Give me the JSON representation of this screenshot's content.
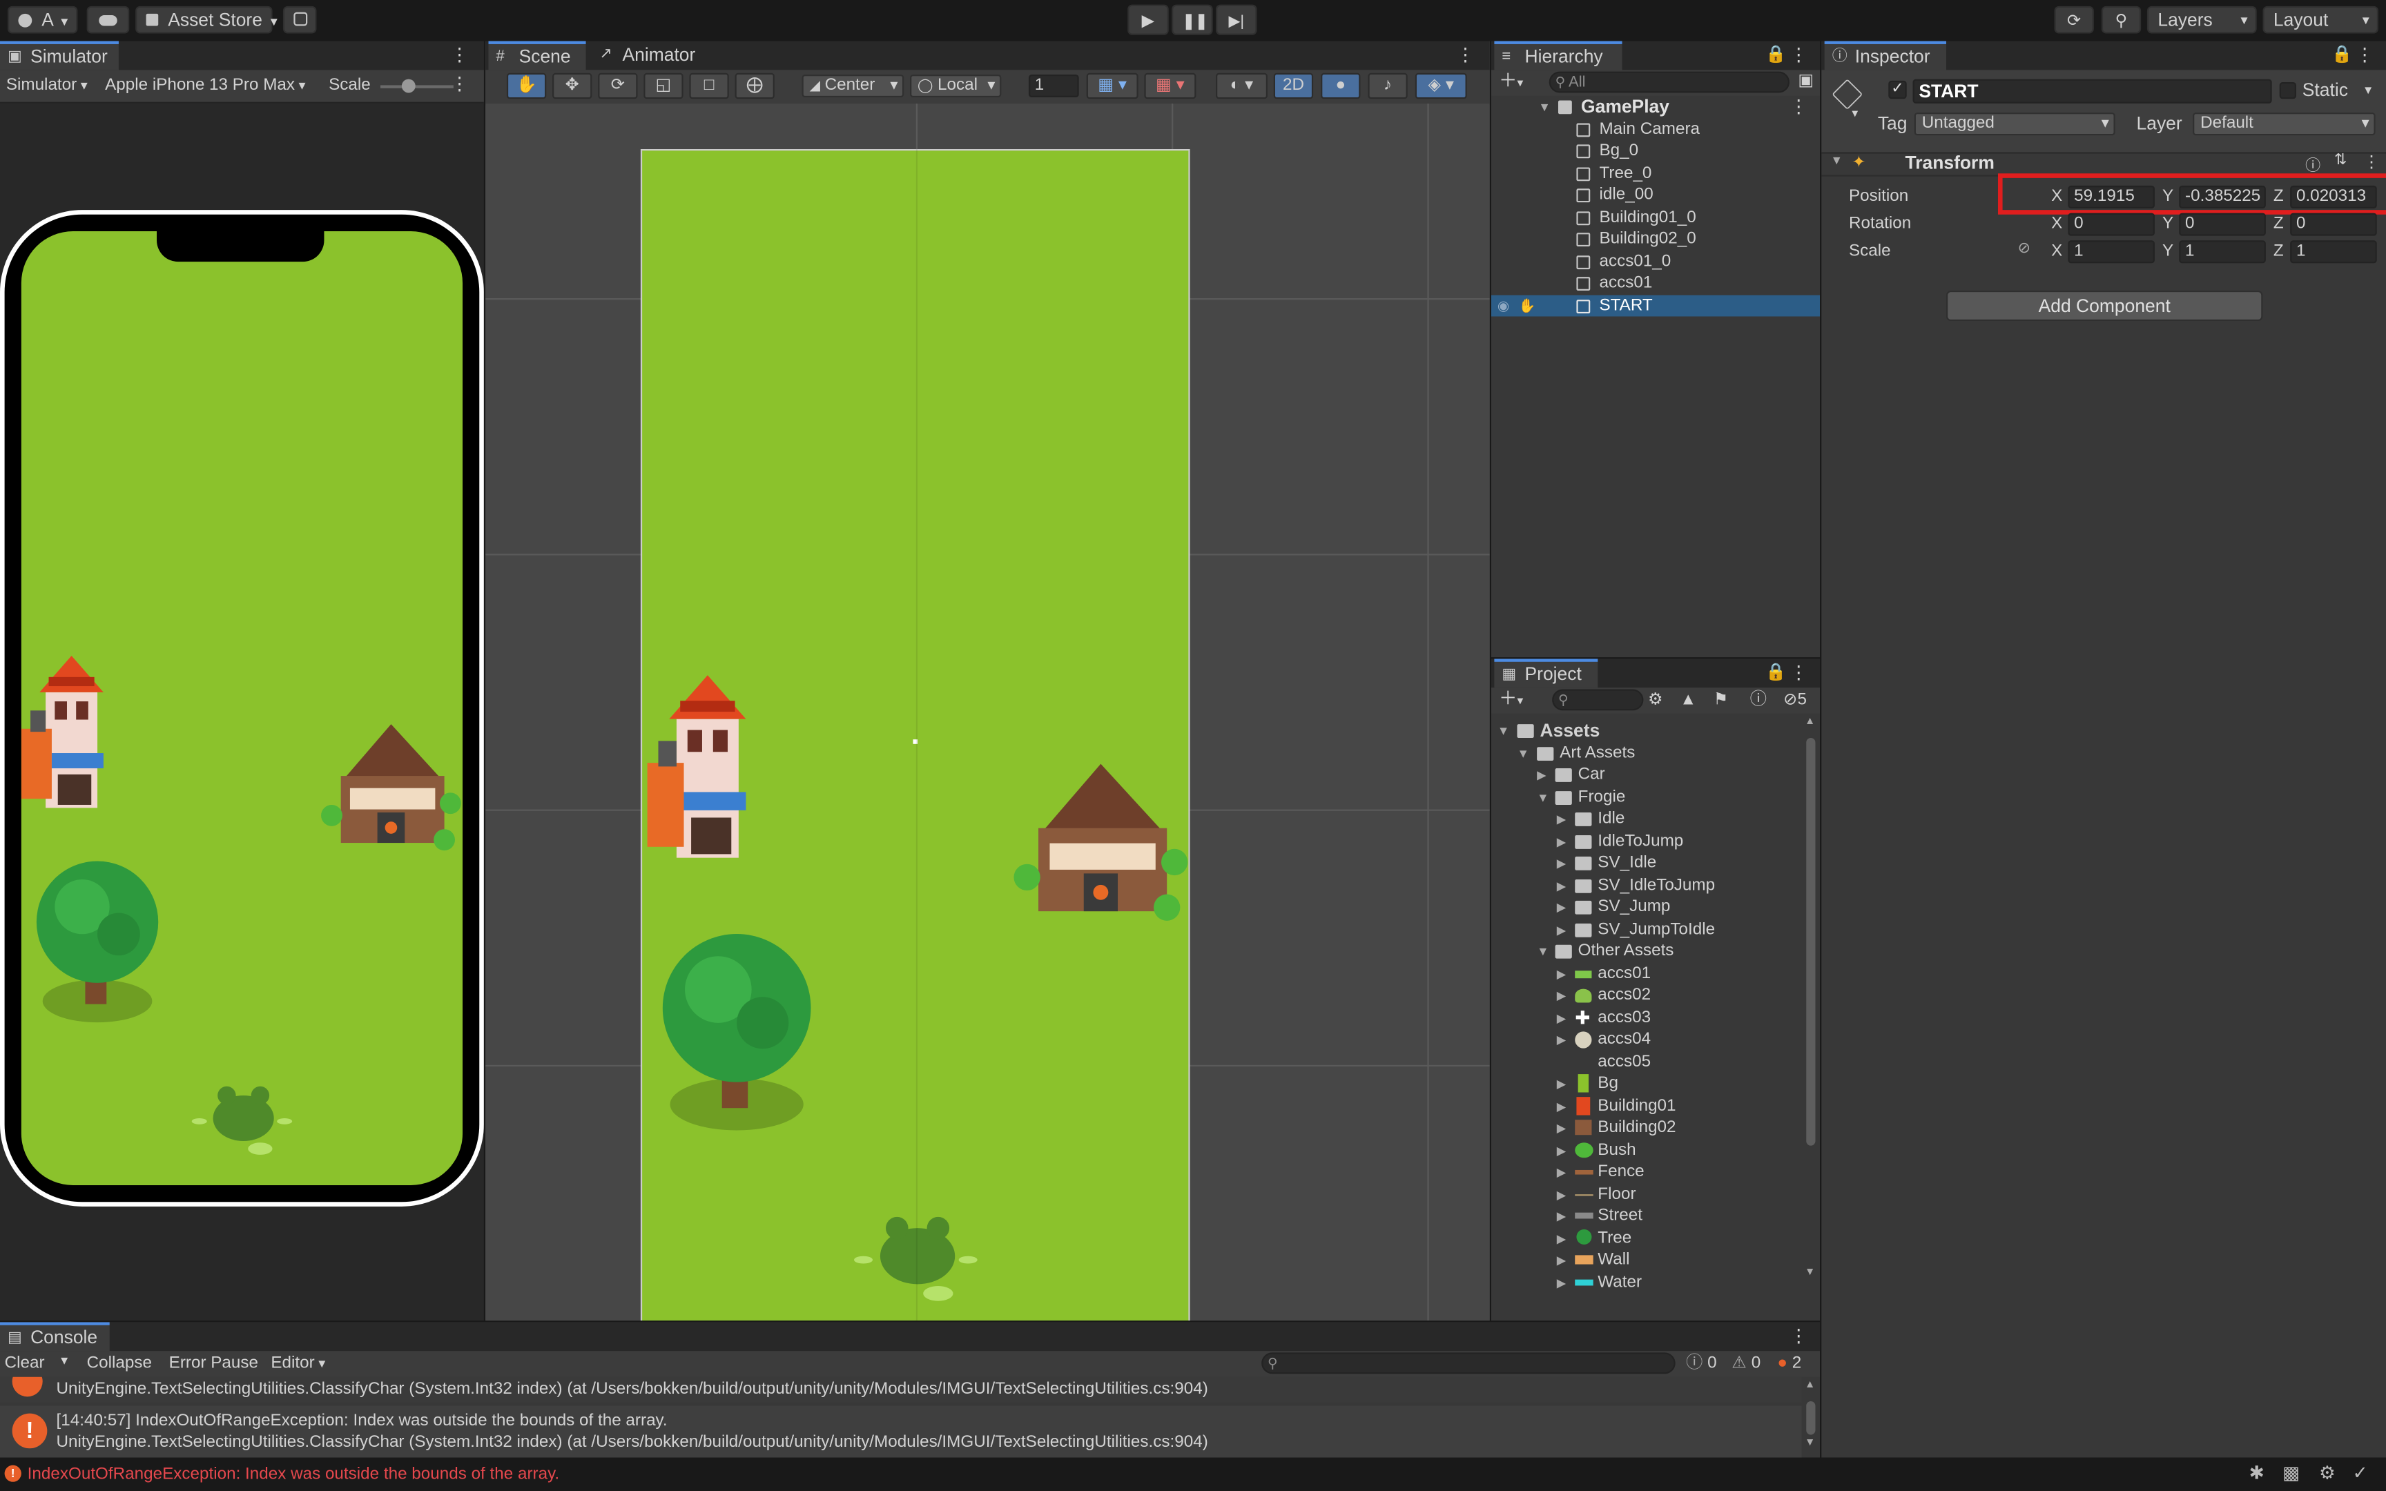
{
  "toolbar": {
    "account_label": "A",
    "asset_store_label": "Asset Store",
    "layers_label": "Layers",
    "layout_label": "Layout"
  },
  "simulator": {
    "tab_label": "Simulator",
    "mode_label": "Simulator",
    "device_label": "Apple iPhone 13 Pro Max",
    "scale_label": "Scale",
    "scale_value": 0.15
  },
  "scene": {
    "tabs": [
      "Scene",
      "Animator"
    ],
    "pivot_label": "Center",
    "space_label": "Local",
    "grid_value": "1",
    "mode_2d_label": "2D"
  },
  "hierarchy": {
    "tab_label": "Hierarchy",
    "search_placeholder": "All",
    "scene_name": "GamePlay",
    "items": [
      "Main Camera",
      "Bg_0",
      "Tree_0",
      "idle_00",
      "Building01_0",
      "Building02_0",
      "accs01_0",
      "accs01",
      "START"
    ],
    "selected": "START"
  },
  "inspector": {
    "tab_label": "Inspector",
    "object_name": "START",
    "static_label": "Static",
    "tag_label": "Tag",
    "tag_value": "Untagged",
    "layer_label": "Layer",
    "layer_value": "Default",
    "component_title": "Transform",
    "position_label": "Position",
    "rotation_label": "Rotation",
    "scale_label": "Scale",
    "axis_x": "X",
    "axis_y": "Y",
    "axis_z": "Z",
    "position": {
      "x": "59.1915",
      "y": "-0.385225",
      "z": "0.020313"
    },
    "rotation": {
      "x": "0",
      "y": "0",
      "z": "0"
    },
    "scale": {
      "x": "1",
      "y": "1",
      "z": "1"
    },
    "add_component_label": "Add Component",
    "highlight_color": "#e01e1e"
  },
  "project": {
    "tab_label": "Project",
    "hidden_count": "5",
    "root": "Assets",
    "art_assets": "Art Assets",
    "car": "Car",
    "frogie": "Frogie",
    "frogie_children": [
      "Idle",
      "IdleToJump",
      "SV_Idle",
      "SV_IdleToJump",
      "SV_Jump",
      "SV_JumpToIdle"
    ],
    "other_assets": "Other Assets",
    "other_children": [
      "accs01",
      "accs02",
      "accs03",
      "accs04",
      "accs05",
      "Bg",
      "Building01",
      "Building02",
      "Bush",
      "Fence",
      "Floor",
      "Street",
      "Tree",
      "Wall",
      "Water"
    ]
  },
  "console": {
    "tab_label": "Console",
    "clear_label": "Clear",
    "collapse_label": "Collapse",
    "error_pause_label": "Error Pause",
    "editor_label": "Editor",
    "log_count": "0",
    "warn_count": "0",
    "error_count": "2",
    "line_partial": "UnityEngine.TextSelectingUtilities.ClassifyChar (System.Int32 index) (at /Users/bokken/build/output/unity/unity/Modules/IMGUI/TextSelectingUtilities.cs:904)",
    "entry_line1": "[14:40:57] IndexOutOfRangeException: Index was outside the bounds of the array.",
    "entry_line2": "UnityEngine.TextSelectingUtilities.ClassifyChar (System.Int32 index) (at /Users/bokken/build/output/unity/unity/Modules/IMGUI/TextSelectingUtilities.cs:904)"
  },
  "status_bar": {
    "message": "IndexOutOfRangeException: Index was outside the bounds of the array.",
    "error_color": "#e5484d"
  },
  "colors": {
    "grass": "#8bc22c",
    "selection": "#2c5d87",
    "accent": "#4d8be2"
  }
}
